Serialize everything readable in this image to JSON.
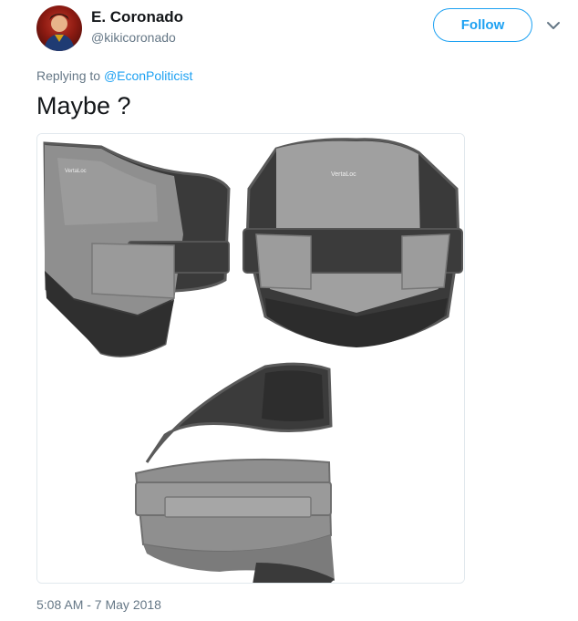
{
  "tweet": {
    "display_name": "E. Coronado",
    "handle": "@kikicoronado",
    "follow_label": "Follow",
    "reply_prefix": "Replying to",
    "reply_mention": "@EconPoliticist",
    "text": "Maybe ?",
    "timestamp": "5:08 AM - 7 May 2018"
  },
  "media": {
    "brand_label": "VertaLoc"
  },
  "icons": {
    "avatar": "user-avatar",
    "menu": "chevron-down-icon"
  },
  "colors": {
    "accent": "#1da1f2",
    "secondary_text": "#657786",
    "primary_text": "#14171a"
  }
}
